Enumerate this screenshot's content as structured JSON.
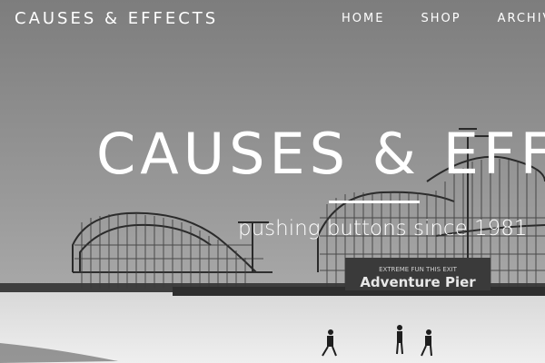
{
  "header": {
    "site_title": "CAUSES & EFFECTS",
    "nav": [
      {
        "label": "HOME"
      },
      {
        "label": "SHOP"
      },
      {
        "label": "ARCHIVE"
      }
    ]
  },
  "hero": {
    "title": "CAUSES & EFFECTS",
    "tagline": "pushing buttons since 1981",
    "sign_text": "Adventure Pier",
    "sign_small": "EXTREME FUN THIS EXIT",
    "image_style": "black-and-white photo"
  },
  "colors": {
    "text": "#ffffff",
    "sky": "#8a8a8a",
    "ground": "#e6e6e6"
  }
}
